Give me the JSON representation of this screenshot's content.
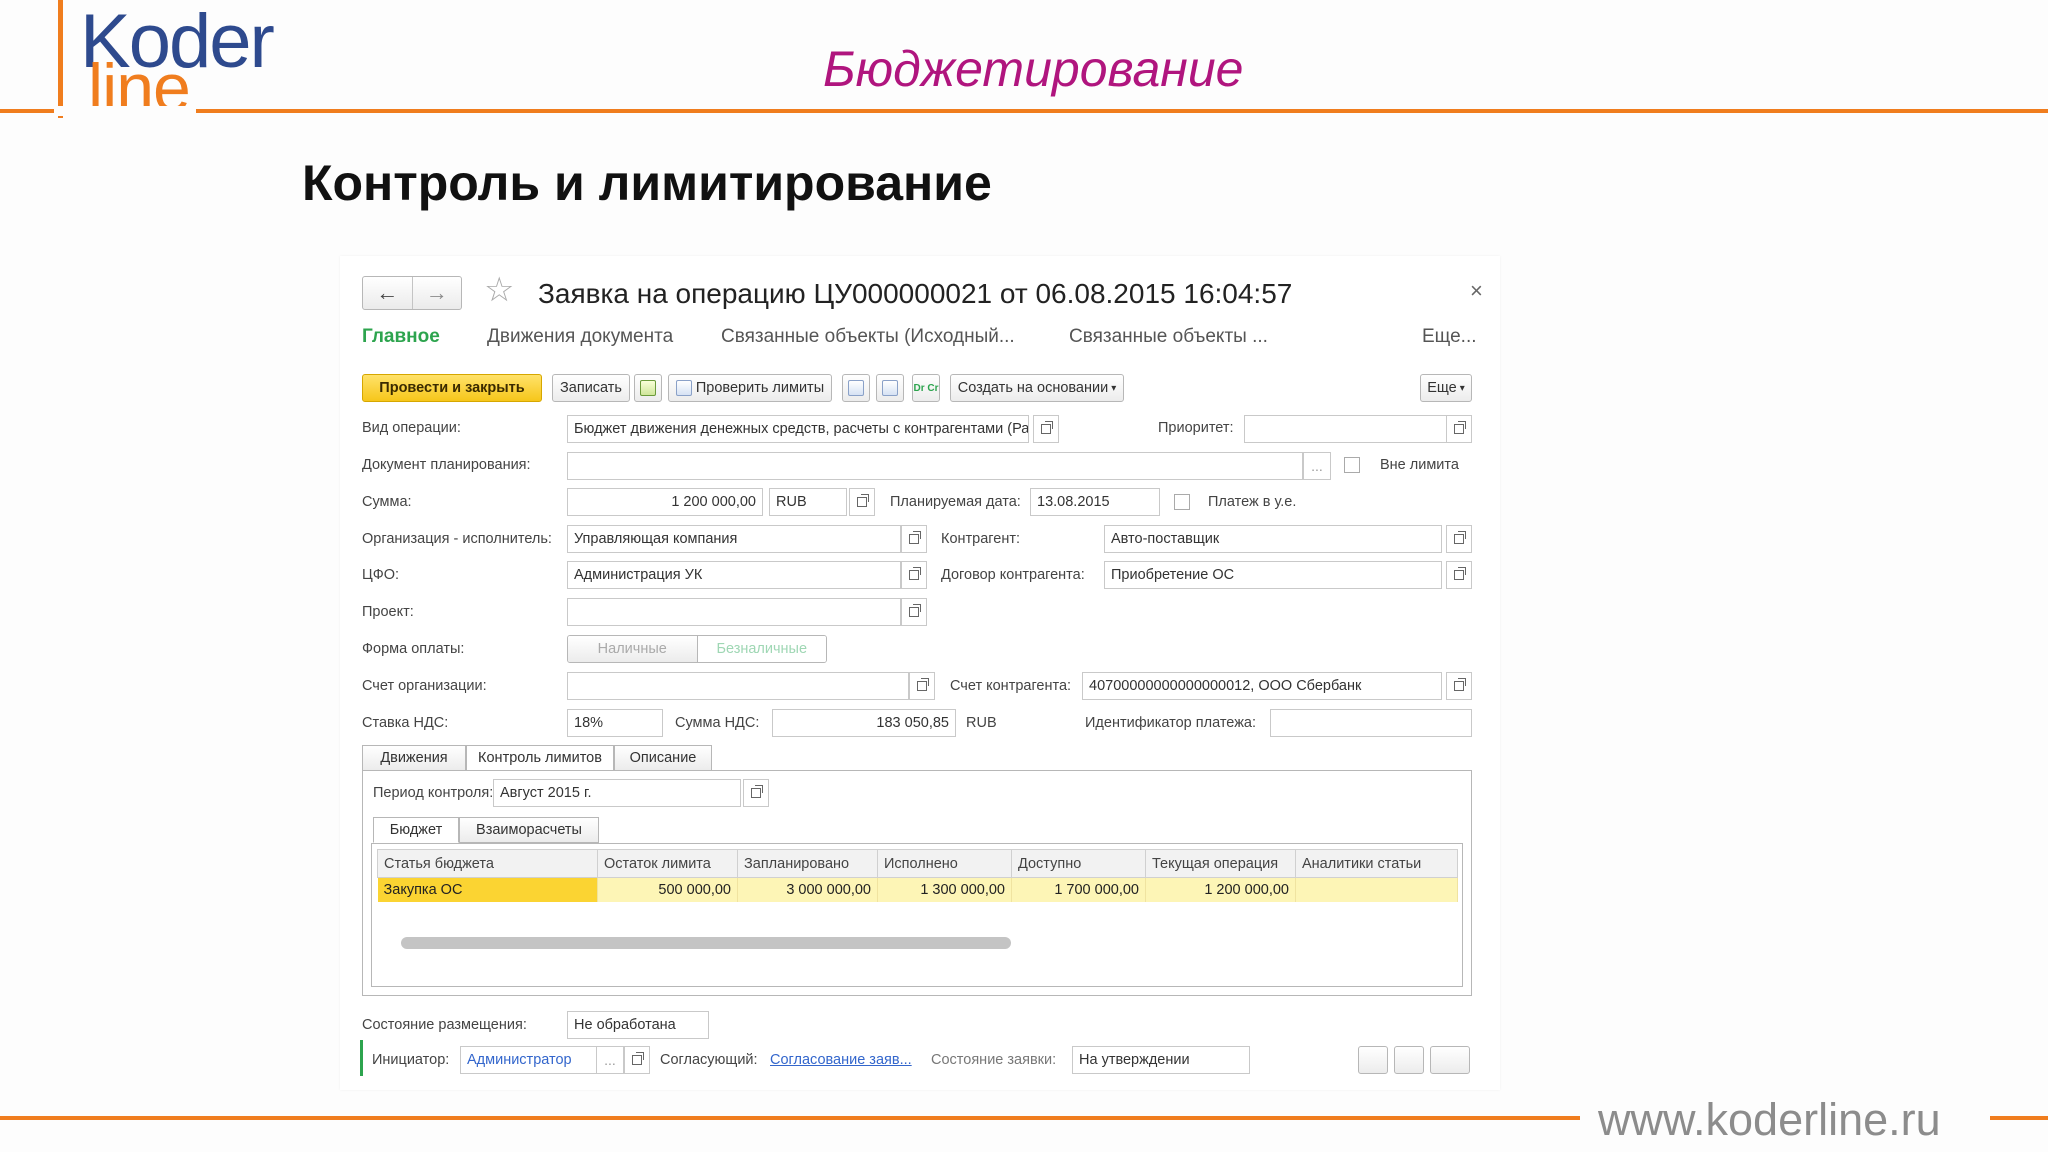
{
  "slide": {
    "logo_top": "Koder",
    "logo_bottom": "line",
    "title": "Бюджетирование",
    "subtitle": "Контроль и лимитирование",
    "website": "www.koderline.ru",
    "accent_color": "#f07d1e",
    "title_color": "#b0157e"
  },
  "window": {
    "title": "Заявка на операцию ЦУ000000021 от 06.08.2015 16:04:57",
    "back_icon": "arrow-left-icon",
    "forward_icon": "arrow-right-icon",
    "favorite_icon": "star-icon",
    "close_label": "×"
  },
  "tabs": [
    "Главное",
    "Движения документа",
    "Связанные объекты (Исходный...",
    "Связанные объекты ...",
    "Еще..."
  ],
  "toolbar": {
    "post_close": "Провести и закрыть",
    "save": "Записать",
    "check_limits": "Проверить лимиты",
    "create_based": "Создать на основании",
    "more": "Еще",
    "dtcr_label": "Dr Cr"
  },
  "form": {
    "op_type_label": "Вид операции:",
    "op_type_value": "Бюджет движения денежных средств, расчеты с контрагентами (Расход)",
    "priority_label": "Приоритет:",
    "priority_value": "",
    "planning_doc_label": "Документ планирования:",
    "planning_doc_value": "",
    "out_of_limit_label": "Вне лимита",
    "amount_label": "Сумма:",
    "amount_value": "1 200 000,00",
    "currency_value": "RUB",
    "planned_date_label": "Планируемая дата:",
    "planned_date_value": "13.08.2015",
    "payment_ue_label": "Платеж в у.е.",
    "org_label": "Организация - исполнитель:",
    "org_value": "Управляющая компания",
    "counterparty_label": "Контрагент:",
    "counterparty_value": "Авто-поставщик",
    "cfo_label": "ЦФО:",
    "cfo_value": "Администрация УК",
    "contract_label": "Договор контрагента:",
    "contract_value": "Приобретение ОС",
    "project_label": "Проект:",
    "project_value": "",
    "payment_form_label": "Форма оплаты:",
    "payment_forms": [
      "Наличные",
      "Безналичные"
    ],
    "org_account_label": "Счет организации:",
    "org_account_value": "",
    "cp_account_label": "Счет контрагента:",
    "cp_account_value": "40700000000000000012, ООО Сбербанк",
    "vat_rate_label": "Ставка НДС:",
    "vat_rate_value": "18%",
    "vat_sum_label": "Сумма НДС:",
    "vat_sum_value": "183 050,85",
    "vat_currency": "RUB",
    "payment_id_label": "Идентификатор платежа:",
    "payment_id_value": ""
  },
  "inner_tabs": [
    "Движения",
    "Контроль лимитов",
    "Описание"
  ],
  "limits": {
    "period_label": "Период контроля:",
    "period_value": "Август 2015 г.",
    "sub_tabs": [
      "Бюджет",
      "Взаиморасчеты"
    ],
    "columns": [
      "Статья бюджета",
      "Остаток лимита",
      "Запланировано",
      "Исполнено",
      "Доступно",
      "Текущая операция",
      "Аналитики статьи"
    ],
    "rows": [
      [
        "Закупка ОС",
        "500 000,00",
        "3 000 000,00",
        "1 300 000,00",
        "1 700 000,00",
        "1 200 000,00",
        ""
      ]
    ]
  },
  "footer": {
    "placement_label": "Состояние размещения:",
    "placement_value": "Не обработана",
    "initiator_label": "Инициатор:",
    "initiator_value": "Администратор",
    "approver_label": "Согласующий:",
    "approver_value": "Согласование заяв...",
    "state_label": "Состояние заявки:",
    "state_value": "На утверждении"
  }
}
